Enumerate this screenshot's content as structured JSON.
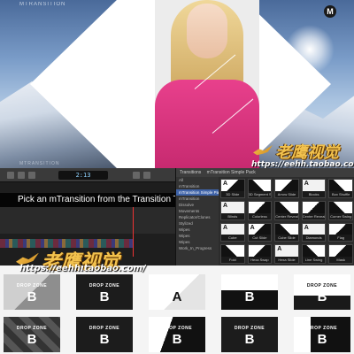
{
  "hero": {
    "brand_top": "MTRANSITION",
    "brand_bottom": "MTRANSITION",
    "badge": "M"
  },
  "watermark": {
    "title": "老鹰视觉",
    "url": "https://eehh.taobao.com/"
  },
  "timeline": {
    "timecode": "2:13",
    "caption": "Pick an mTransition from the Transition Tab"
  },
  "browser": {
    "header": [
      "Transitions",
      "mTransition Simple Pack"
    ],
    "categories": [
      {
        "label": "All",
        "selected": false
      },
      {
        "label": "mTransition",
        "selected": false
      },
      {
        "label": "mTransition Simple Pack",
        "selected": true
      },
      {
        "label": "mTransition",
        "selected": false
      },
      {
        "label": "Dissolve",
        "selected": false
      },
      {
        "label": "Movements",
        "selected": false
      },
      {
        "label": "Replicator/Clones",
        "selected": false
      },
      {
        "label": "Stylized",
        "selected": false
      },
      {
        "label": "Wipes",
        "selected": false
      },
      {
        "label": "Wipes",
        "selected": false
      },
      {
        "label": "Wipes",
        "selected": false
      },
      {
        "label": "Work_In_Progress",
        "selected": false
      }
    ],
    "thumbnails": [
      {
        "label": "3D Slide",
        "letter": "A",
        "style": "diag"
      },
      {
        "label": "3D Segment Slide",
        "letter": "A",
        "style": "alt"
      },
      {
        "label": "Arrow Slide",
        "letter": "",
        "style": "diag"
      },
      {
        "label": "Blocks",
        "letter": "A",
        "style": "plain"
      },
      {
        "label": "Box Shuffle",
        "letter": "A",
        "style": "alt"
      },
      {
        "label": "Blinds",
        "letter": "A",
        "style": "plain"
      },
      {
        "label": "Colorless",
        "letter": "",
        "style": "diag"
      },
      {
        "label": "Center Reveal",
        "letter": "",
        "style": "alt"
      },
      {
        "label": "Center Reveal",
        "letter": "",
        "style": "diag"
      },
      {
        "label": "Corner Swing",
        "letter": "",
        "style": "alt"
      },
      {
        "label": "Cube",
        "letter": "A",
        "style": "plain"
      },
      {
        "label": "Cut Slide",
        "letter": "A",
        "style": "diag"
      },
      {
        "label": "Cube Slide",
        "letter": "",
        "style": "alt"
      },
      {
        "label": "Diamonds",
        "letter": "A",
        "style": "plain"
      },
      {
        "label": "Flag",
        "letter": "",
        "style": "diag"
      },
      {
        "label": "Fold",
        "letter": "",
        "style": "alt"
      },
      {
        "label": "Hexa Swap",
        "letter": "",
        "style": "diag"
      },
      {
        "label": "Hexa Slide",
        "letter": "A",
        "style": "plain"
      },
      {
        "label": "Line Swing",
        "letter": "",
        "style": "alt"
      },
      {
        "label": "Mask",
        "letter": "",
        "style": "diag"
      }
    ]
  },
  "drop_zones": [
    {
      "text": "DROP ZONE",
      "letter": "B",
      "theme": "gray"
    },
    {
      "text": "DROP ZONE",
      "letter": "B",
      "theme": "dark"
    },
    {
      "text": "",
      "letter": "A",
      "theme": "light"
    },
    {
      "text": "DROP ZONE",
      "letter": "B",
      "theme": "split"
    },
    {
      "text": "DROP ZONE",
      "letter": "B",
      "theme": "lightB"
    },
    {
      "text": "DROP ZONE",
      "letter": "B",
      "theme": "tiles"
    },
    {
      "text": "DROP ZONE",
      "letter": "B",
      "theme": "dark"
    },
    {
      "text": "DROP ZONE",
      "letter": "B",
      "theme": "diag"
    },
    {
      "text": "DROP ZONE",
      "letter": "B",
      "theme": "dark"
    },
    {
      "text": "DROP ZONE",
      "letter": "B",
      "theme": "arrow"
    }
  ]
}
